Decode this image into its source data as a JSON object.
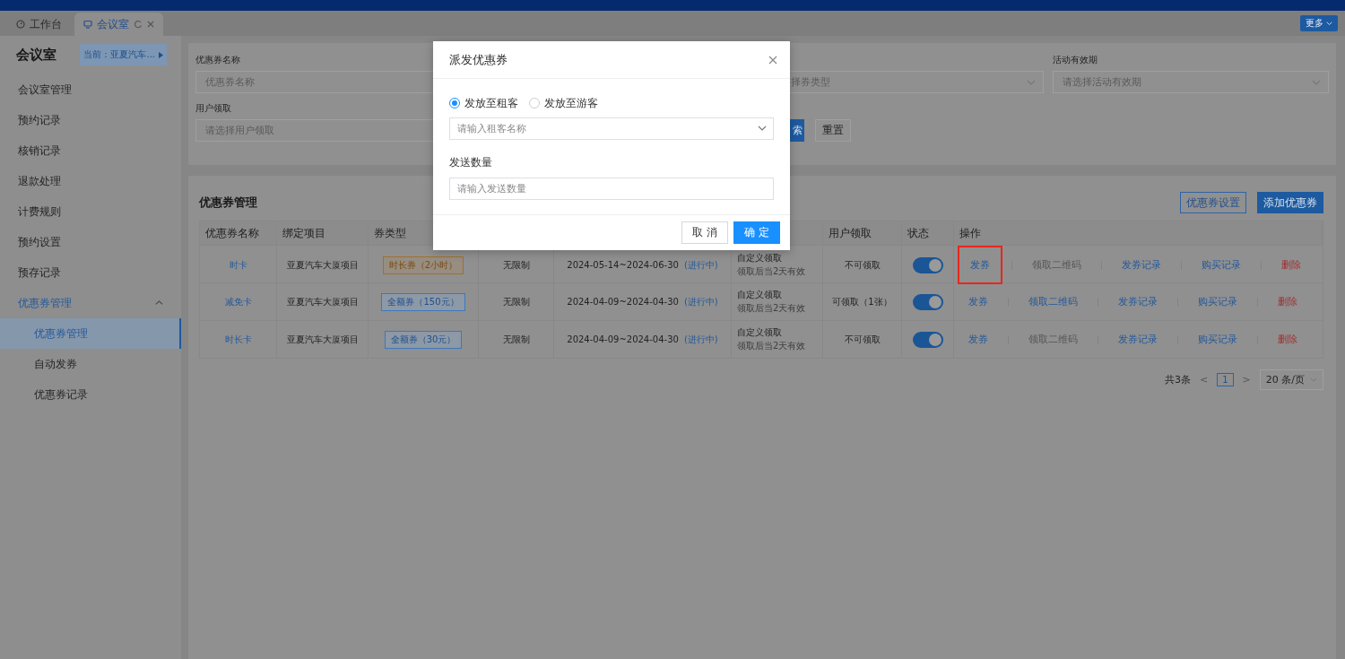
{
  "tabs": [
    {
      "label": "工作台",
      "selected": false,
      "closable": false
    },
    {
      "label": "会议室",
      "selected": true,
      "closable": true
    }
  ],
  "more_button": "更多",
  "sidebar": {
    "title": "会议室",
    "current": "当前：亚夏汽车...",
    "items": [
      {
        "label": "会议室管理",
        "selected": false
      },
      {
        "label": "预约记录",
        "selected": false
      },
      {
        "label": "核销记录",
        "selected": false
      },
      {
        "label": "退款处理",
        "selected": false
      },
      {
        "label": "计费规则",
        "selected": false
      },
      {
        "label": "预约设置",
        "selected": false
      },
      {
        "label": "预存记录",
        "selected": false
      },
      {
        "label": "优惠券管理",
        "selected": false,
        "expanded": true,
        "children": [
          {
            "label": "优惠券管理",
            "selected": true
          },
          {
            "label": "自动发券",
            "selected": false
          },
          {
            "label": "优惠券记录",
            "selected": false
          }
        ]
      }
    ]
  },
  "filters": {
    "coupon_name": {
      "label": "优惠券名称",
      "placeholder": "优惠券名称"
    },
    "coupon_type": {
      "placeholder": "择券类型"
    },
    "validity": {
      "label": "活动有效期",
      "placeholder": "请选择活动有效期"
    },
    "user_claim": {
      "label": "用户领取",
      "placeholder": "请选择用户领取"
    },
    "search_button": "索",
    "reset_button": "重置"
  },
  "table": {
    "title": "优惠券管理",
    "buttons": [
      {
        "label": "优惠券设置",
        "kind": "outline"
      },
      {
        "label": "添加优惠券",
        "kind": "primary"
      }
    ],
    "columns": {
      "name": "优惠券名称",
      "project": "绑定项目",
      "type": "券类型",
      "user": "用户领取",
      "status": "状态",
      "actions": "操作"
    },
    "rows": [
      {
        "name": "时卡",
        "project": "亚夏汽车大厦项目",
        "tag": {
          "text": "时长券（2小时）",
          "kind": "duration"
        },
        "limit": "无限制",
        "period": "2024-05-14~2024-06-30",
        "period_status": "(进行中)",
        "receive": "自定义领取",
        "receive_note": "领取后当2天有效",
        "user": "不可领取",
        "on": true,
        "actions": [
          {
            "label": "发券",
            "kind": "link",
            "highlighted": true
          },
          {
            "label": "领取二维码",
            "kind": "disabled",
            "highlighted": false
          },
          {
            "label": "发券记录",
            "kind": "link",
            "highlighted": false
          },
          {
            "label": "购买记录",
            "kind": "link",
            "highlighted": false
          },
          {
            "label": "删除",
            "kind": "danger",
            "highlighted": false
          }
        ]
      },
      {
        "name": "减免卡",
        "project": "亚夏汽车大厦项目",
        "tag": {
          "text": "全额券（150元）",
          "kind": "amount"
        },
        "limit": "无限制",
        "period": "2024-04-09~2024-04-30",
        "period_status": "(进行中)",
        "receive": "自定义领取",
        "receive_note": "领取后当2天有效",
        "user": "可领取（1张）",
        "on": true,
        "actions": [
          {
            "label": "发券",
            "kind": "link",
            "highlighted": false
          },
          {
            "label": "领取二维码",
            "kind": "link",
            "highlighted": false
          },
          {
            "label": "发券记录",
            "kind": "link",
            "highlighted": false
          },
          {
            "label": "购买记录",
            "kind": "link",
            "highlighted": false
          },
          {
            "label": "删除",
            "kind": "danger",
            "highlighted": false
          }
        ]
      },
      {
        "name": "时长卡",
        "project": "亚夏汽车大厦项目",
        "tag": {
          "text": "全额券（30元）",
          "kind": "amount"
        },
        "limit": "无限制",
        "period": "2024-04-09~2024-04-30",
        "period_status": "(进行中)",
        "receive": "自定义领取",
        "receive_note": "领取后当2天有效",
        "user": "不可领取",
        "on": true,
        "actions": [
          {
            "label": "发券",
            "kind": "link",
            "highlighted": false
          },
          {
            "label": "领取二维码",
            "kind": "disabled",
            "highlighted": false
          },
          {
            "label": "发券记录",
            "kind": "link",
            "highlighted": false
          },
          {
            "label": "购买记录",
            "kind": "link",
            "highlighted": false
          },
          {
            "label": "删除",
            "kind": "danger",
            "highlighted": false
          }
        ]
      }
    ]
  },
  "pagination": {
    "total": "共3条",
    "prev": "<",
    "page": "1",
    "next": ">",
    "page_size": "20 条/页"
  },
  "dialog": {
    "title": "派发优惠券",
    "options": [
      {
        "label": "发放至租客",
        "selected": true
      },
      {
        "label": "发放至游客",
        "selected": false
      }
    ],
    "tenant_placeholder": "请输入租客名称",
    "quantity_label": "发送数量",
    "quantity_placeholder": "请输入发送数量",
    "cancel": "取 消",
    "confirm": "确 定"
  }
}
